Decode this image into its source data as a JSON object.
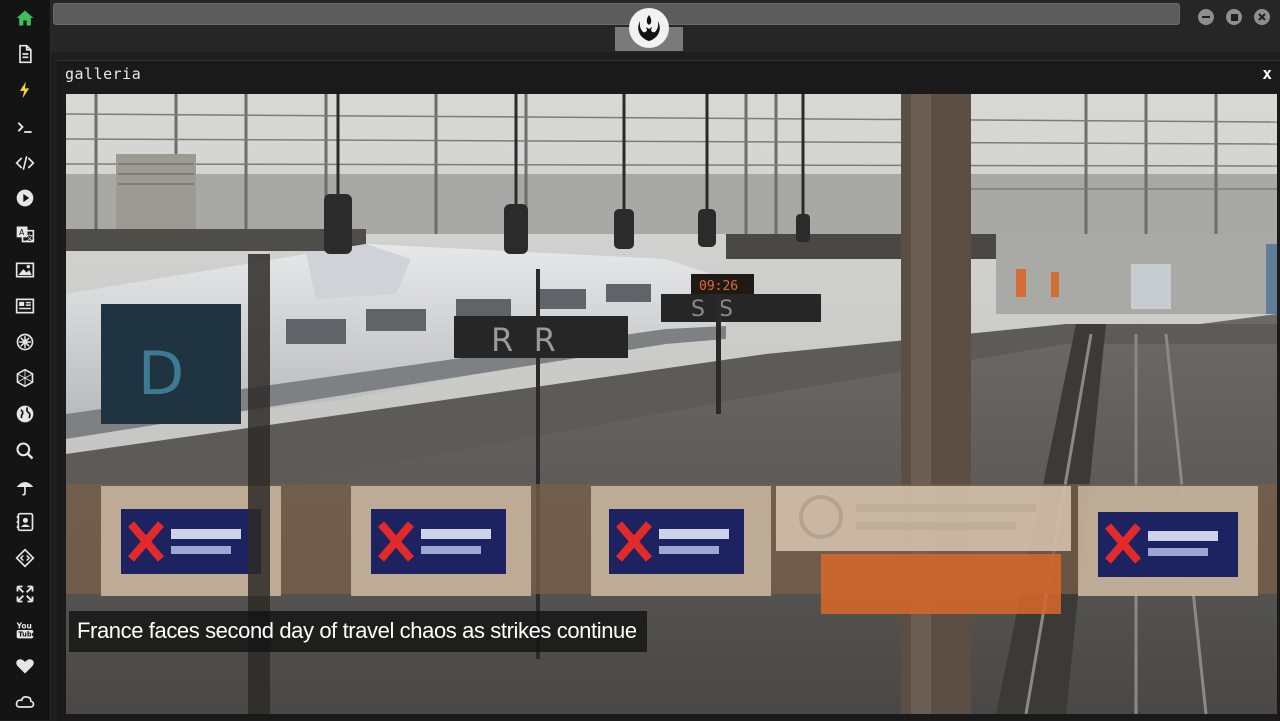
{
  "sidebar": {
    "items": [
      {
        "name": "home-icon",
        "color": "#3fbf5a"
      },
      {
        "name": "document-icon"
      },
      {
        "name": "lightning-icon",
        "color": "#f5d23b"
      },
      {
        "name": "terminal-icon"
      },
      {
        "name": "code-icon"
      },
      {
        "name": "play-icon"
      },
      {
        "name": "translate-icon"
      },
      {
        "name": "image-icon"
      },
      {
        "name": "newspaper-icon"
      },
      {
        "name": "settings-icon"
      },
      {
        "name": "hexagon-icon"
      },
      {
        "name": "globe-icon"
      },
      {
        "name": "search-icon"
      },
      {
        "name": "umbrella-icon"
      },
      {
        "name": "contact-icon"
      },
      {
        "name": "dev-tools-icon"
      },
      {
        "name": "expand-icon"
      },
      {
        "name": "youtube-icon"
      },
      {
        "name": "heart-icon"
      },
      {
        "name": "cloud-icon"
      }
    ]
  },
  "window": {
    "title": "galleria",
    "close_label": "x"
  },
  "gallery": {
    "caption": "France faces second day of travel chaos as strikes continue",
    "photo_signs": {
      "platform_letter": "D",
      "sign_r": "R  R",
      "sign_s": "S  S",
      "clock": "09:26"
    }
  },
  "colors": {
    "accent_home": "#3fbf5a",
    "accent_lightning": "#f5d23b"
  }
}
